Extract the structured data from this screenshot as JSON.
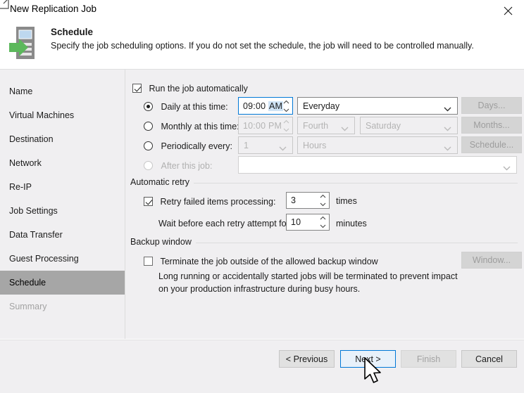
{
  "window": {
    "title": "New Replication Job",
    "close_label": "✕",
    "icon": "replication-job-icon"
  },
  "header": {
    "title": "Schedule",
    "subtitle": "Specify the job scheduling options. If you do not set the schedule, the job will need to be controlled manually.",
    "icon": "schedule-server-arrow-icon"
  },
  "sidebar": {
    "items": [
      {
        "label": "Name",
        "state": "normal"
      },
      {
        "label": "Virtual Machines",
        "state": "normal"
      },
      {
        "label": "Destination",
        "state": "normal"
      },
      {
        "label": "Network",
        "state": "normal"
      },
      {
        "label": "Re-IP",
        "state": "normal"
      },
      {
        "label": "Job Settings",
        "state": "normal"
      },
      {
        "label": "Data Transfer",
        "state": "normal"
      },
      {
        "label": "Guest Processing",
        "state": "normal"
      },
      {
        "label": "Schedule",
        "state": "selected"
      },
      {
        "label": "Summary",
        "state": "disabled"
      }
    ]
  },
  "main": {
    "run_automatically": {
      "label": "Run the job automatically",
      "checked": true
    },
    "schedule_modes": {
      "selected": "daily",
      "daily": {
        "label": "Daily at this time:",
        "time_value": "09:00 ",
        "time_suffix": "AM",
        "frequency": "Everyday",
        "button": "Days..."
      },
      "monthly": {
        "label": "Monthly at this time:",
        "time_value": "10:00 PM",
        "week_ordinal": "Fourth",
        "weekday": "Saturday",
        "button": "Months..."
      },
      "periodically": {
        "label": "Periodically every:",
        "interval": "1",
        "unit": "Hours",
        "button": "Schedule..."
      },
      "after_job": {
        "label": "After this job:",
        "value": ""
      }
    },
    "automatic_retry": {
      "group_label": "Automatic retry",
      "retry_checkbox_label": "Retry failed items processing:",
      "retry_checked": true,
      "retry_count": "3",
      "retry_count_unit": "times",
      "wait_label": "Wait before each retry attempt for:",
      "wait_value": "10",
      "wait_unit": "minutes"
    },
    "backup_window": {
      "group_label": "Backup window",
      "terminate_label": "Terminate the job outside of the allowed backup window",
      "terminate_checked": false,
      "description_line1": "Long running or accidentally started jobs will be terminated to prevent impact",
      "description_line2": "on your production infrastructure during busy hours.",
      "button": "Window..."
    }
  },
  "footer": {
    "previous": "< Previous",
    "next": "Next >",
    "finish": "Finish",
    "cancel": "Cancel"
  },
  "colors": {
    "accent": "#0078d7",
    "selection": "#cfe3f5",
    "sidebar_selected": "#a6a6a6",
    "body_bg": "#f0eff1",
    "icon_green": "#5cb85c"
  }
}
